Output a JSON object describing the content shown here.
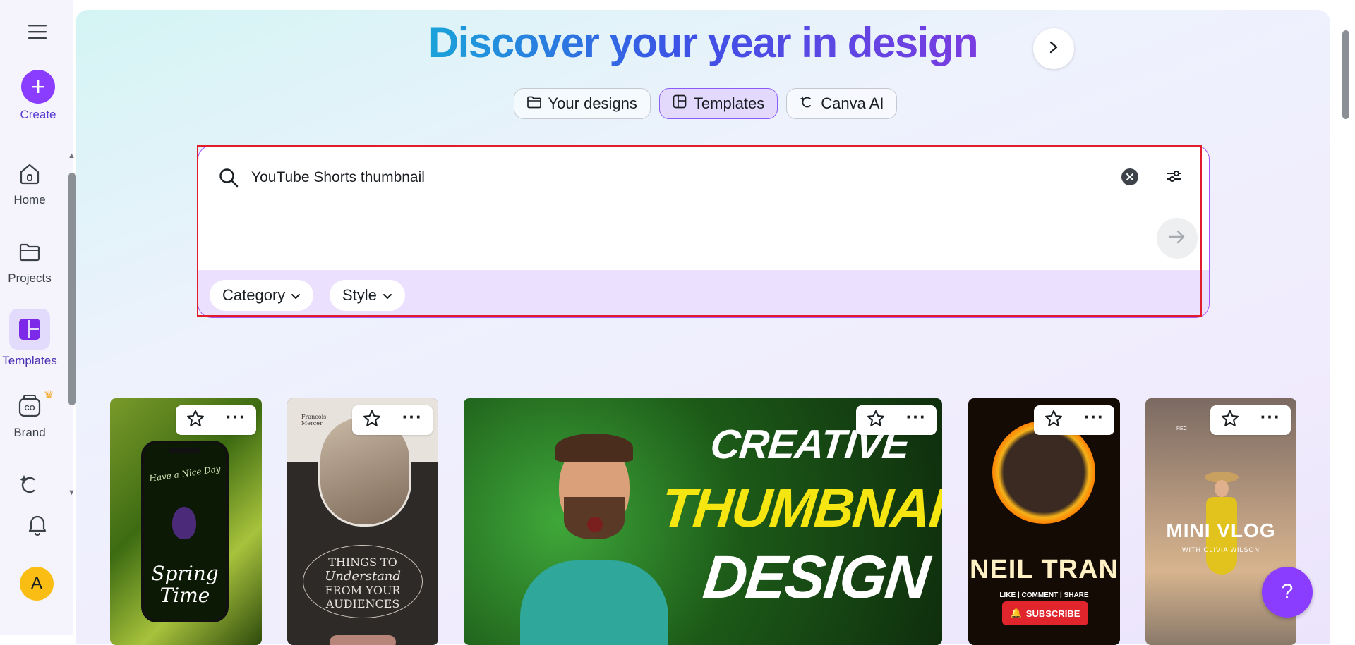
{
  "rail": {
    "create": "Create",
    "home": "Home",
    "projects": "Projects",
    "templates": "Templates",
    "brand": "Brand",
    "avatar_initial": "A"
  },
  "hero": {
    "title": "Discover your year in design"
  },
  "tabs": [
    {
      "label": "Your designs",
      "icon": "folder-icon"
    },
    {
      "label": "Templates",
      "icon": "template-icon"
    },
    {
      "label": "Canva AI",
      "icon": "canva-ai-icon"
    }
  ],
  "search": {
    "value": "YouTube Shorts thumbnail"
  },
  "chips": {
    "category": "Category",
    "style": "Style"
  },
  "cards": [
    {
      "title_line1": "Have a Nice Day",
      "title_line2": "Spring Time"
    },
    {
      "brand": "Francois Mercer",
      "line1": "THINGS TO",
      "line2": "Understand",
      "line3": "FROM YOUR",
      "line4": "AUDIENCES"
    },
    {
      "line1": "CREATIVE",
      "line2": "THUMBNAIL",
      "line3": "DESIGN"
    },
    {
      "name": "NEIL TRAN",
      "sub": "LIKE | COMMENT | SHARE",
      "button": "SUBSCRIBE"
    },
    {
      "tag": "REC",
      "title": "MINI VLOG",
      "sub": "WITH OLIVIA WILSON"
    }
  ],
  "help": "?",
  "colors": {
    "brand_purple": "#8b3dff",
    "highlight_red": "#e11d2c"
  }
}
